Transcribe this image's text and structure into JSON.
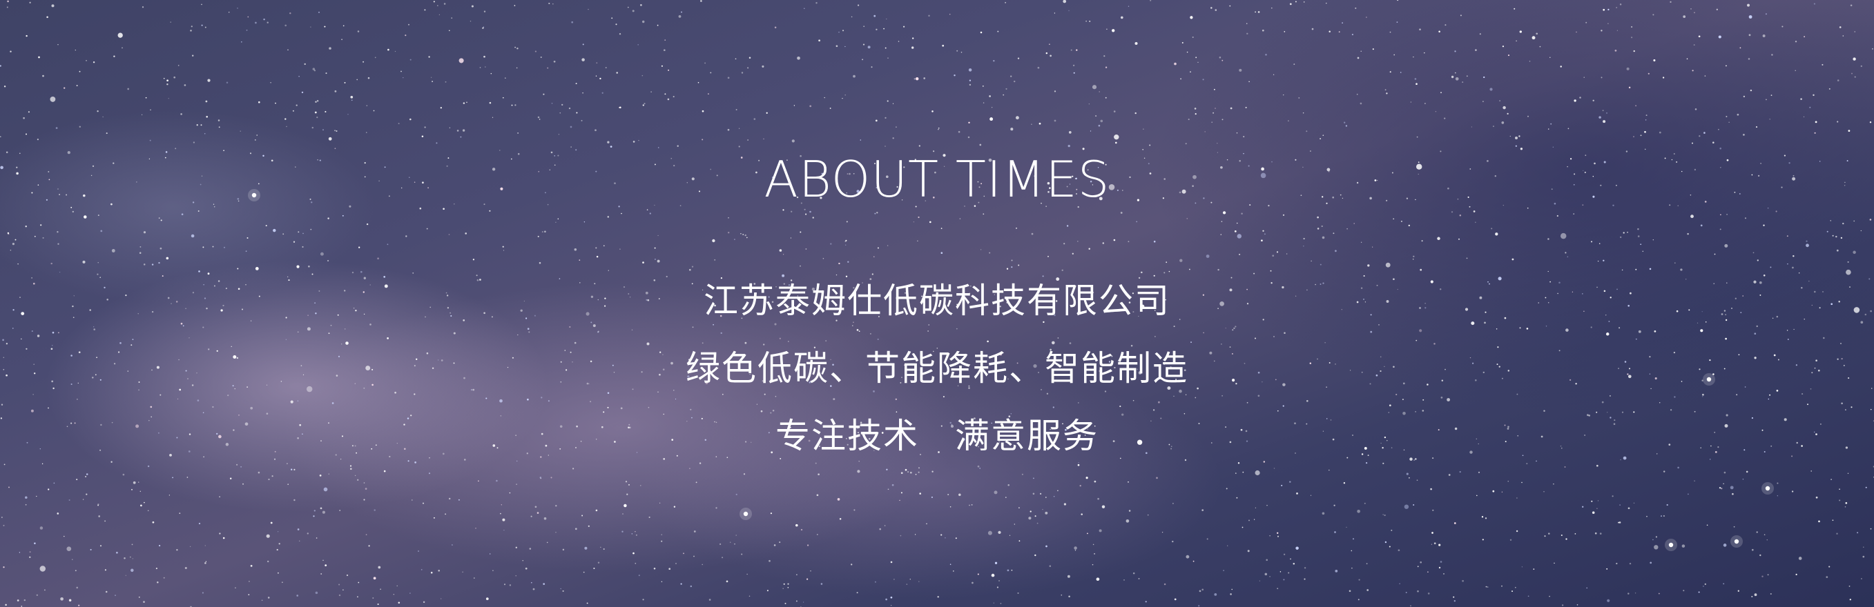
{
  "banner": {
    "title": "ABOUT TIMES",
    "company_name": "江苏泰姆仕低碳科技有限公司",
    "slogan": "绿色低碳、节能降耗、智能制造",
    "motto_part1": "专注技术",
    "motto_part2": "满意服务"
  },
  "colors": {
    "text": "#ffffff",
    "sky_dark": "#2c3158",
    "sky_light": "#5a5478"
  }
}
